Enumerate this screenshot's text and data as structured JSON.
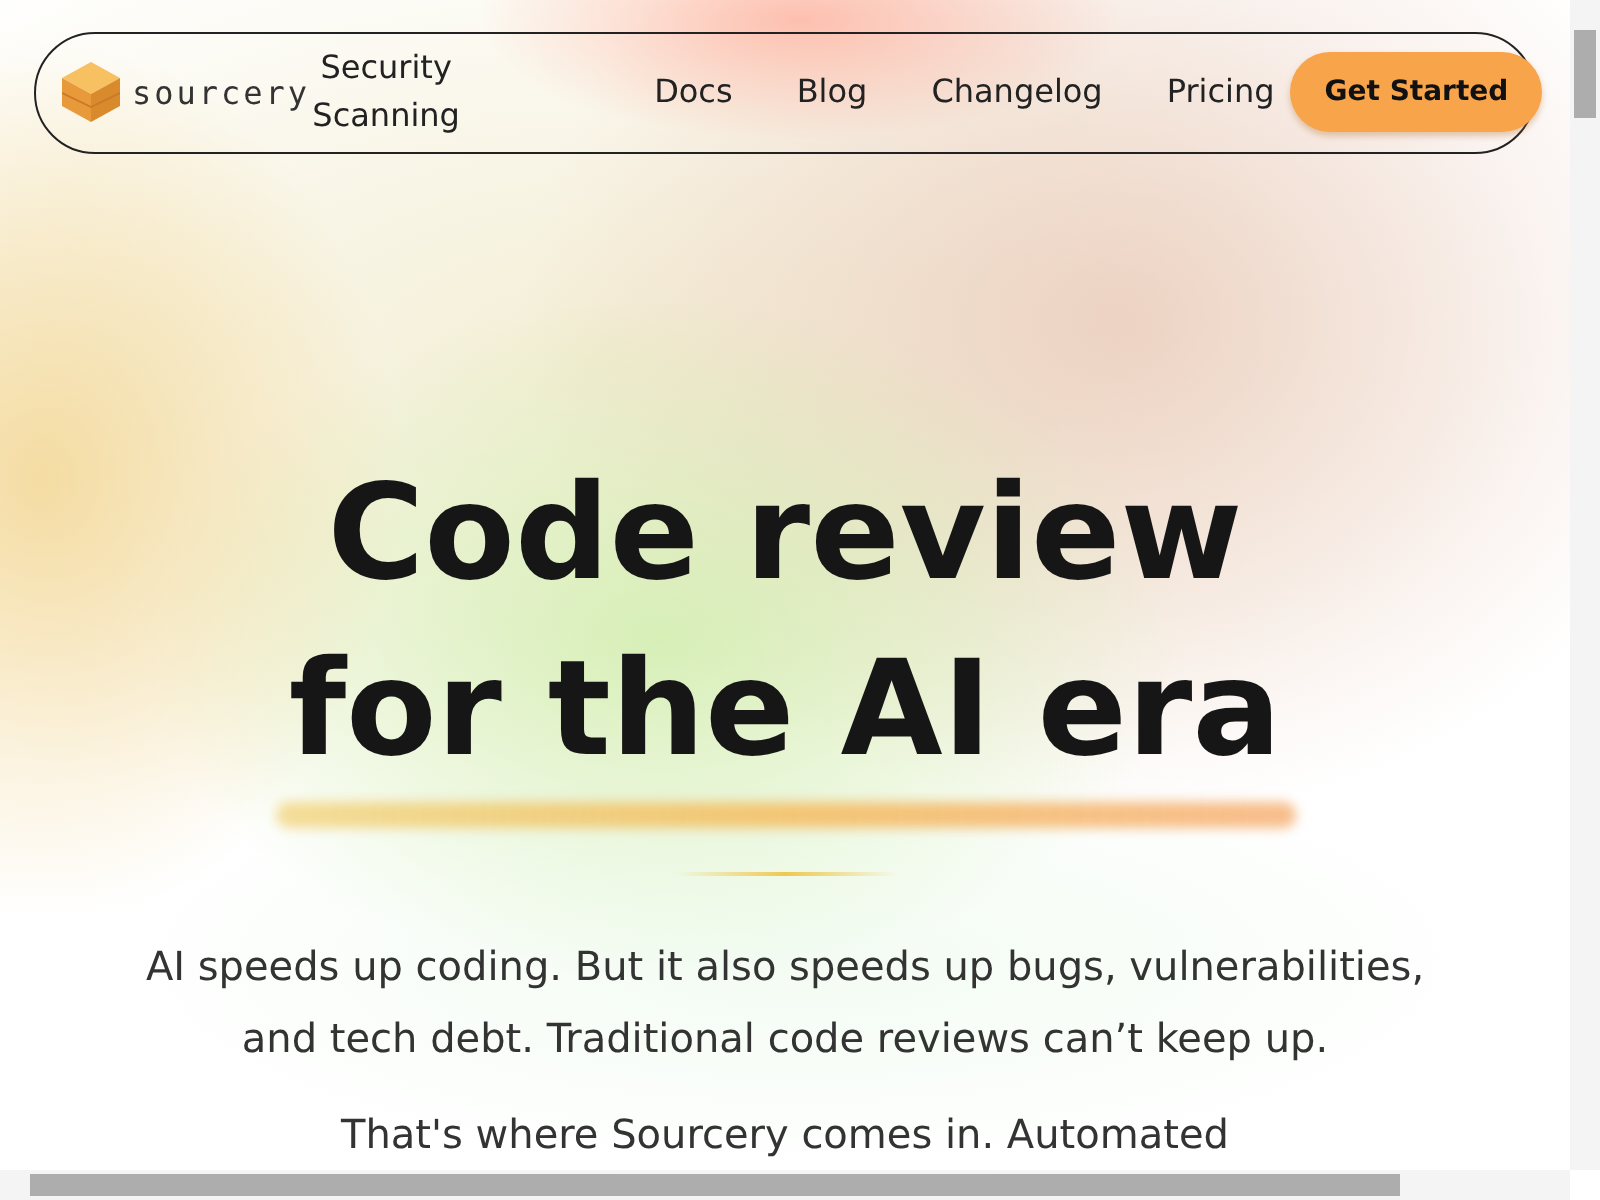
{
  "nav": {
    "brand": "sourcery",
    "links": [
      {
        "label": "Security Scanning"
      },
      {
        "label": "Docs"
      },
      {
        "label": "Blog"
      },
      {
        "label": "Changelog"
      },
      {
        "label": "Pricing"
      }
    ],
    "cta": "Get Started"
  },
  "hero": {
    "title_lines": [
      "Code review",
      "for the AI era"
    ],
    "paragraphs": [
      "AI speeds up coding. But it also speeds up bugs, vulnerabilities, and tech debt. Traditional code reviews can’t keep up.",
      "That's where Sourcery comes in. Automated"
    ]
  }
}
